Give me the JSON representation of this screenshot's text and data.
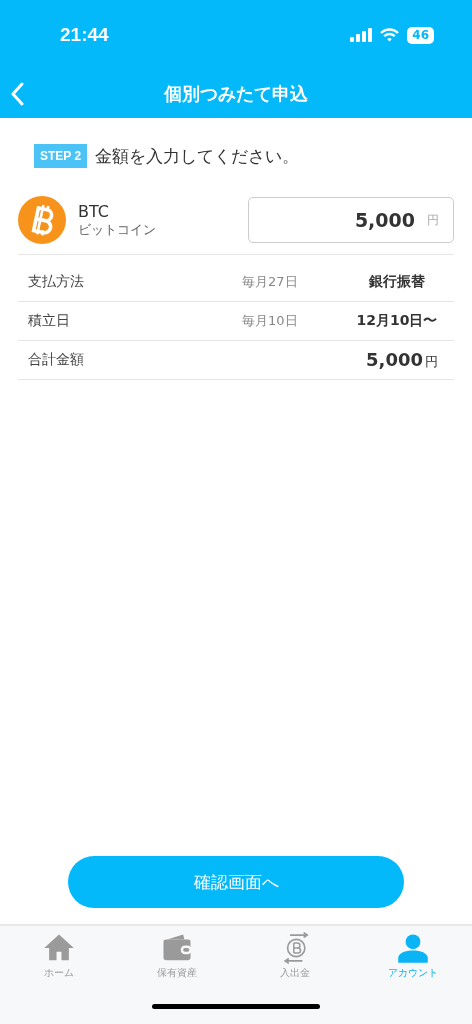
{
  "status_bar": {
    "time": "21:44",
    "battery": "46"
  },
  "header": {
    "title": "個別つみたて申込"
  },
  "step": {
    "badge": "STEP 2",
    "instruction": "金額を入力してください。"
  },
  "coin": {
    "symbol": "BTC",
    "name": "ビットコイン",
    "amount": "5,000",
    "unit": "円"
  },
  "details": [
    {
      "label": "支払方法",
      "date": "毎月27日",
      "value": "銀行振替"
    },
    {
      "label": "積立日",
      "date": "毎月10日",
      "value": "12月10日〜"
    }
  ],
  "total": {
    "label": "合計金額",
    "value": "5,000",
    "unit": "円"
  },
  "confirm_button": "確認画面へ",
  "tabs": [
    {
      "kind": "home",
      "label": "ホーム",
      "selected": false
    },
    {
      "kind": "wallet",
      "label": "保有資産",
      "selected": false
    },
    {
      "kind": "transfer",
      "label": "入出金",
      "selected": false
    },
    {
      "kind": "person",
      "label": "アカウント",
      "selected": true
    }
  ]
}
